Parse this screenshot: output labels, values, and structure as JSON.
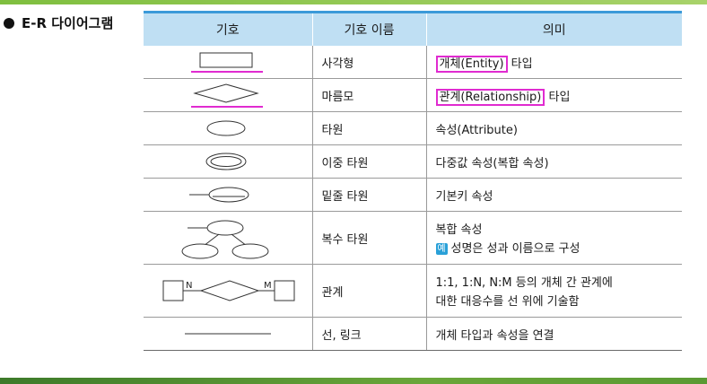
{
  "section": {
    "title": "E-R 다이어그램"
  },
  "table": {
    "headers": [
      "기호",
      "기호 이름",
      "의미"
    ],
    "rows": [
      {
        "name": "사각형",
        "meaning_highlight": "개체(Entity)",
        "meaning_rest": " 타입"
      },
      {
        "name": "마름모",
        "meaning_highlight": "관계(Relationship)",
        "meaning_rest": " 타입"
      },
      {
        "name": "타원",
        "meaning": "속성(Attribute)"
      },
      {
        "name": "이중 타원",
        "meaning": "다중값 속성(복합 속성)"
      },
      {
        "name": "밑줄 타원",
        "meaning": "기본키 속성"
      },
      {
        "name": "복수 타원",
        "meaning_line1": "복합 속성",
        "example_badge": "예",
        "meaning_line2": "성명은 성과 이름으로 구성"
      },
      {
        "name": "관계",
        "meaning_line1": "1:1, 1:N, N:M 등의 개체 간 관계에",
        "meaning_line2": "대한 대응수를 선 위에 기술함",
        "label_n": "N",
        "label_m": "M"
      },
      {
        "name": "선, 링크",
        "meaning": "개체 타입과 속성을 연결"
      }
    ]
  },
  "colors": {
    "header_bg": "#bfdff3",
    "header_border": "#3b9ad9",
    "highlight": "#e02bd0",
    "badge": "#29a0d8"
  }
}
